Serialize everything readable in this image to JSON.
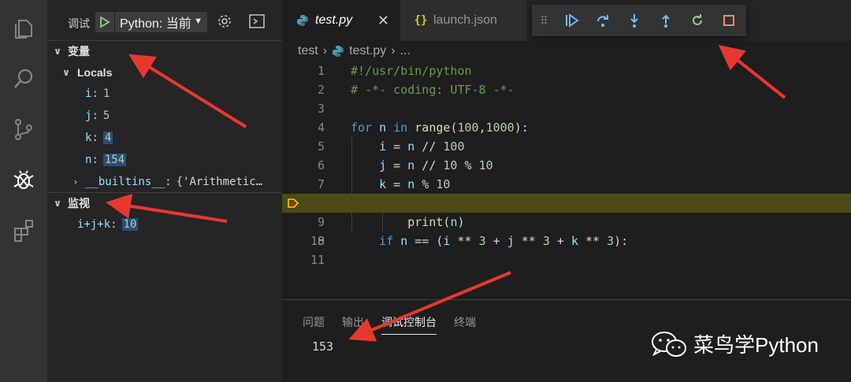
{
  "activity_bar": {
    "icons": [
      "files-icon",
      "search-icon",
      "source-control-icon",
      "debug-icon",
      "extensions-icon"
    ]
  },
  "sidebar": {
    "debug_label": "调试",
    "config_select": "Python: 当前",
    "variables_header": "变量",
    "locals_label": "Locals",
    "variables": [
      {
        "name": "i",
        "value": "1",
        "highlight": false
      },
      {
        "name": "j",
        "value": "5",
        "highlight": false
      },
      {
        "name": "k",
        "value": "4",
        "highlight": true
      },
      {
        "name": "n",
        "value": "154",
        "highlight": true
      }
    ],
    "builtins": {
      "name": "__builtins__",
      "value": "{'Arithmetic…"
    },
    "watch_header": "监视",
    "watch": [
      {
        "expr": "i+j+k",
        "value": "10"
      }
    ]
  },
  "editor": {
    "tabs": [
      {
        "label": "test.py",
        "active": true
      },
      {
        "label": "launch.json",
        "active": false
      }
    ],
    "breadcrumb": {
      "folder": "test",
      "file": "test.py",
      "more": "..."
    },
    "current_line": 8
  },
  "panel": {
    "tabs": [
      "问题",
      "输出",
      "调试控制台",
      "终端"
    ],
    "active_tab": "调试控制台",
    "output": "153"
  },
  "watermark": {
    "text": "菜鸟学Python"
  },
  "colors": {
    "accent_blue": "#75beff",
    "restart_green": "#89d185",
    "stop_red": "#f48771",
    "arrow_red": "#e8382e",
    "current_line_bg": "#4b4b18"
  }
}
